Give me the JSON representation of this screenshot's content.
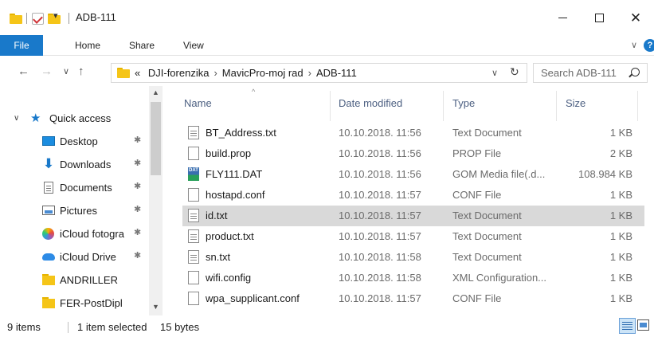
{
  "window": {
    "title": "ADB-111",
    "qa_dropdown": "▾",
    "minimize_glyph": "",
    "close_glyph": "✕"
  },
  "ribbon": {
    "tabs": [
      {
        "label": "File"
      },
      {
        "label": "Home"
      },
      {
        "label": "Share"
      },
      {
        "label": "View"
      }
    ],
    "help": "?",
    "expand": "∨"
  },
  "nav": {
    "back": "←",
    "forward": "→",
    "recent": "∨",
    "up": "↑"
  },
  "address": {
    "overflow": "«",
    "crumbs": [
      "DJI-forenzika",
      "MavicPro-moj rad",
      "ADB-111"
    ],
    "separator": "›",
    "dropdown": "∨",
    "refresh": "↻"
  },
  "search": {
    "placeholder": "Search ADB-111"
  },
  "navpane": {
    "quick_access": "Quick access",
    "expander": "∨",
    "star": "★",
    "pin": "✱",
    "items": [
      {
        "label": "Desktop",
        "pinned": true,
        "icon": "desktop-icon"
      },
      {
        "label": "Downloads",
        "pinned": true,
        "icon": "download-arrow-icon"
      },
      {
        "label": "Documents",
        "pinned": true,
        "icon": "document-icon"
      },
      {
        "label": "Pictures",
        "pinned": true,
        "icon": "pictures-icon"
      },
      {
        "label": "iCloud fotogra",
        "pinned": true,
        "icon": "icloud-photos-icon"
      },
      {
        "label": "iCloud Drive",
        "pinned": true,
        "icon": "icloud-drive-icon"
      },
      {
        "label": "ANDRILLER",
        "pinned": false,
        "icon": "folder-icon"
      },
      {
        "label": "FER-PostDipl",
        "pinned": false,
        "icon": "folder-icon"
      }
    ],
    "scroll_up": "▲",
    "scroll_down": "▼"
  },
  "filelist": {
    "columns": {
      "name": "Name",
      "date": "Date modified",
      "type": "Type",
      "size": "Size",
      "sort_caret": "^"
    },
    "rows": [
      {
        "name": "BT_Address.txt",
        "date": "10.10.2018. 11:56",
        "type": "Text Document",
        "size": "1 KB",
        "icon": "lines",
        "selected": false
      },
      {
        "name": "build.prop",
        "date": "10.10.2018. 11:56",
        "type": "PROP File",
        "size": "2 KB",
        "icon": "blank",
        "selected": false
      },
      {
        "name": "FLY111.DAT",
        "date": "10.10.2018. 11:56",
        "type": "GOM Media file(.d...",
        "size": "108.984 KB",
        "icon": "dat",
        "selected": false
      },
      {
        "name": "hostapd.conf",
        "date": "10.10.2018. 11:57",
        "type": "CONF File",
        "size": "1 KB",
        "icon": "blank",
        "selected": false
      },
      {
        "name": "id.txt",
        "date": "10.10.2018. 11:57",
        "type": "Text Document",
        "size": "1 KB",
        "icon": "lines",
        "selected": true
      },
      {
        "name": "product.txt",
        "date": "10.10.2018. 11:57",
        "type": "Text Document",
        "size": "1 KB",
        "icon": "lines",
        "selected": false
      },
      {
        "name": "sn.txt",
        "date": "10.10.2018. 11:58",
        "type": "Text Document",
        "size": "1 KB",
        "icon": "lines",
        "selected": false
      },
      {
        "name": "wifi.config",
        "date": "10.10.2018. 11:58",
        "type": "XML Configuration...",
        "size": "1 KB",
        "icon": "blank",
        "selected": false
      },
      {
        "name": "wpa_supplicant.conf",
        "date": "10.10.2018. 11:57",
        "type": "CONF File",
        "size": "1 KB",
        "icon": "blank",
        "selected": false
      }
    ]
  },
  "status": {
    "items_count": "9 items",
    "selection": "1 item selected",
    "size": "15 bytes"
  },
  "colors": {
    "accent": "#1979ca",
    "selected_row": "#d9d9d9",
    "folder": "#f5c518"
  }
}
